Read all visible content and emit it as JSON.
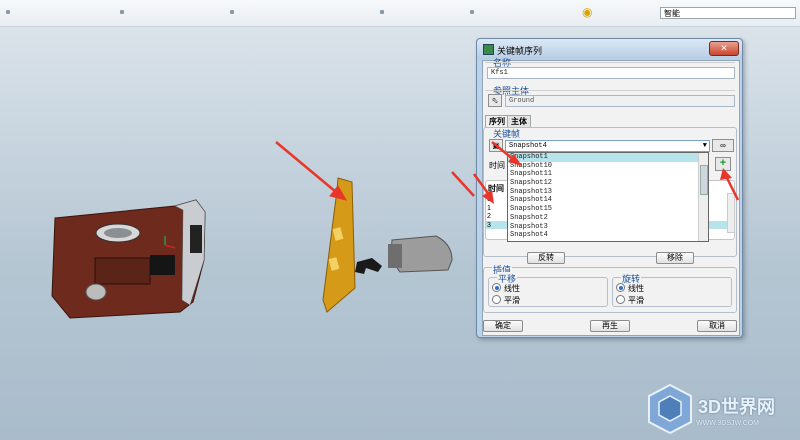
{
  "toolbar": {
    "search_value": "智能"
  },
  "dialog": {
    "title": "关键帧序列",
    "close_label": "✕",
    "name_group": "名称",
    "name_value": "Kfs1",
    "ref_group": "参照主体",
    "ref_value": "Ground",
    "tabs": [
      "序列",
      "主体"
    ],
    "keyframe_group": "关键帧",
    "keyframe_selected": "Snapshot4",
    "time_label": "时间",
    "time_col_header": "时间",
    "time_rows": [
      "0",
      "1",
      "2",
      "3"
    ],
    "dropdown_options": [
      "Snapshot1",
      "Snapshot10",
      "Snapshot11",
      "Snapshot12",
      "Snapshot13",
      "Snapshot14",
      "Snapshot15",
      "Snapshot2",
      "Snapshot3",
      "Snapshot4"
    ],
    "dropdown_selected_index": 0,
    "reverse_button": "反转",
    "remove_button": "移除",
    "interp_group": "插值",
    "translate_group": "平移",
    "rotate_group": "旋转",
    "linear": "线性",
    "smooth": "平滑",
    "ok_button": "确定",
    "regen_button": "再生",
    "cancel_button": "取消"
  },
  "watermark": {
    "brand": "3D世界网",
    "url": "WWW.3DSJW.COM"
  },
  "colors": {
    "accent": "#1a4f98",
    "arrow": "#e8372a",
    "selection": "#b7e3ea"
  }
}
